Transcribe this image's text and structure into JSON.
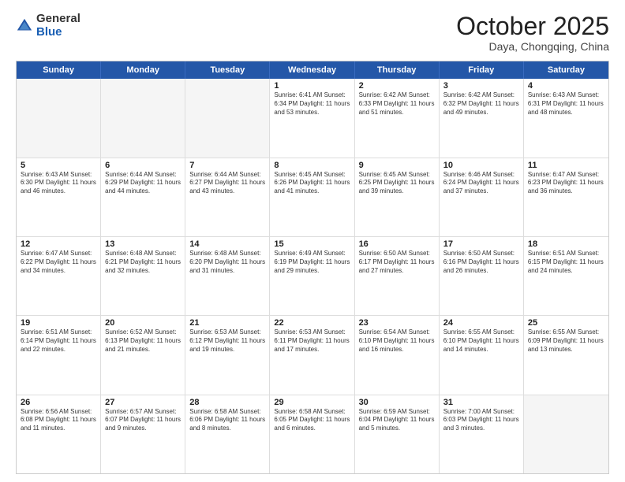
{
  "header": {
    "logo_general": "General",
    "logo_blue": "Blue",
    "month": "October 2025",
    "location": "Daya, Chongqing, China"
  },
  "weekdays": [
    "Sunday",
    "Monday",
    "Tuesday",
    "Wednesday",
    "Thursday",
    "Friday",
    "Saturday"
  ],
  "weeks": [
    [
      {
        "day": "",
        "text": "",
        "empty": true
      },
      {
        "day": "",
        "text": "",
        "empty": true
      },
      {
        "day": "",
        "text": "",
        "empty": true
      },
      {
        "day": "1",
        "text": "Sunrise: 6:41 AM\nSunset: 6:34 PM\nDaylight: 11 hours and 53 minutes.",
        "empty": false
      },
      {
        "day": "2",
        "text": "Sunrise: 6:42 AM\nSunset: 6:33 PM\nDaylight: 11 hours and 51 minutes.",
        "empty": false
      },
      {
        "day": "3",
        "text": "Sunrise: 6:42 AM\nSunset: 6:32 PM\nDaylight: 11 hours and 49 minutes.",
        "empty": false
      },
      {
        "day": "4",
        "text": "Sunrise: 6:43 AM\nSunset: 6:31 PM\nDaylight: 11 hours and 48 minutes.",
        "empty": false
      }
    ],
    [
      {
        "day": "5",
        "text": "Sunrise: 6:43 AM\nSunset: 6:30 PM\nDaylight: 11 hours and 46 minutes.",
        "empty": false
      },
      {
        "day": "6",
        "text": "Sunrise: 6:44 AM\nSunset: 6:29 PM\nDaylight: 11 hours and 44 minutes.",
        "empty": false
      },
      {
        "day": "7",
        "text": "Sunrise: 6:44 AM\nSunset: 6:27 PM\nDaylight: 11 hours and 43 minutes.",
        "empty": false
      },
      {
        "day": "8",
        "text": "Sunrise: 6:45 AM\nSunset: 6:26 PM\nDaylight: 11 hours and 41 minutes.",
        "empty": false
      },
      {
        "day": "9",
        "text": "Sunrise: 6:45 AM\nSunset: 6:25 PM\nDaylight: 11 hours and 39 minutes.",
        "empty": false
      },
      {
        "day": "10",
        "text": "Sunrise: 6:46 AM\nSunset: 6:24 PM\nDaylight: 11 hours and 37 minutes.",
        "empty": false
      },
      {
        "day": "11",
        "text": "Sunrise: 6:47 AM\nSunset: 6:23 PM\nDaylight: 11 hours and 36 minutes.",
        "empty": false
      }
    ],
    [
      {
        "day": "12",
        "text": "Sunrise: 6:47 AM\nSunset: 6:22 PM\nDaylight: 11 hours and 34 minutes.",
        "empty": false
      },
      {
        "day": "13",
        "text": "Sunrise: 6:48 AM\nSunset: 6:21 PM\nDaylight: 11 hours and 32 minutes.",
        "empty": false
      },
      {
        "day": "14",
        "text": "Sunrise: 6:48 AM\nSunset: 6:20 PM\nDaylight: 11 hours and 31 minutes.",
        "empty": false
      },
      {
        "day": "15",
        "text": "Sunrise: 6:49 AM\nSunset: 6:19 PM\nDaylight: 11 hours and 29 minutes.",
        "empty": false
      },
      {
        "day": "16",
        "text": "Sunrise: 6:50 AM\nSunset: 6:17 PM\nDaylight: 11 hours and 27 minutes.",
        "empty": false
      },
      {
        "day": "17",
        "text": "Sunrise: 6:50 AM\nSunset: 6:16 PM\nDaylight: 11 hours and 26 minutes.",
        "empty": false
      },
      {
        "day": "18",
        "text": "Sunrise: 6:51 AM\nSunset: 6:15 PM\nDaylight: 11 hours and 24 minutes.",
        "empty": false
      }
    ],
    [
      {
        "day": "19",
        "text": "Sunrise: 6:51 AM\nSunset: 6:14 PM\nDaylight: 11 hours and 22 minutes.",
        "empty": false
      },
      {
        "day": "20",
        "text": "Sunrise: 6:52 AM\nSunset: 6:13 PM\nDaylight: 11 hours and 21 minutes.",
        "empty": false
      },
      {
        "day": "21",
        "text": "Sunrise: 6:53 AM\nSunset: 6:12 PM\nDaylight: 11 hours and 19 minutes.",
        "empty": false
      },
      {
        "day": "22",
        "text": "Sunrise: 6:53 AM\nSunset: 6:11 PM\nDaylight: 11 hours and 17 minutes.",
        "empty": false
      },
      {
        "day": "23",
        "text": "Sunrise: 6:54 AM\nSunset: 6:10 PM\nDaylight: 11 hours and 16 minutes.",
        "empty": false
      },
      {
        "day": "24",
        "text": "Sunrise: 6:55 AM\nSunset: 6:10 PM\nDaylight: 11 hours and 14 minutes.",
        "empty": false
      },
      {
        "day": "25",
        "text": "Sunrise: 6:55 AM\nSunset: 6:09 PM\nDaylight: 11 hours and 13 minutes.",
        "empty": false
      }
    ],
    [
      {
        "day": "26",
        "text": "Sunrise: 6:56 AM\nSunset: 6:08 PM\nDaylight: 11 hours and 11 minutes.",
        "empty": false
      },
      {
        "day": "27",
        "text": "Sunrise: 6:57 AM\nSunset: 6:07 PM\nDaylight: 11 hours and 9 minutes.",
        "empty": false
      },
      {
        "day": "28",
        "text": "Sunrise: 6:58 AM\nSunset: 6:06 PM\nDaylight: 11 hours and 8 minutes.",
        "empty": false
      },
      {
        "day": "29",
        "text": "Sunrise: 6:58 AM\nSunset: 6:05 PM\nDaylight: 11 hours and 6 minutes.",
        "empty": false
      },
      {
        "day": "30",
        "text": "Sunrise: 6:59 AM\nSunset: 6:04 PM\nDaylight: 11 hours and 5 minutes.",
        "empty": false
      },
      {
        "day": "31",
        "text": "Sunrise: 7:00 AM\nSunset: 6:03 PM\nDaylight: 11 hours and 3 minutes.",
        "empty": false
      },
      {
        "day": "",
        "text": "",
        "empty": true
      }
    ]
  ]
}
